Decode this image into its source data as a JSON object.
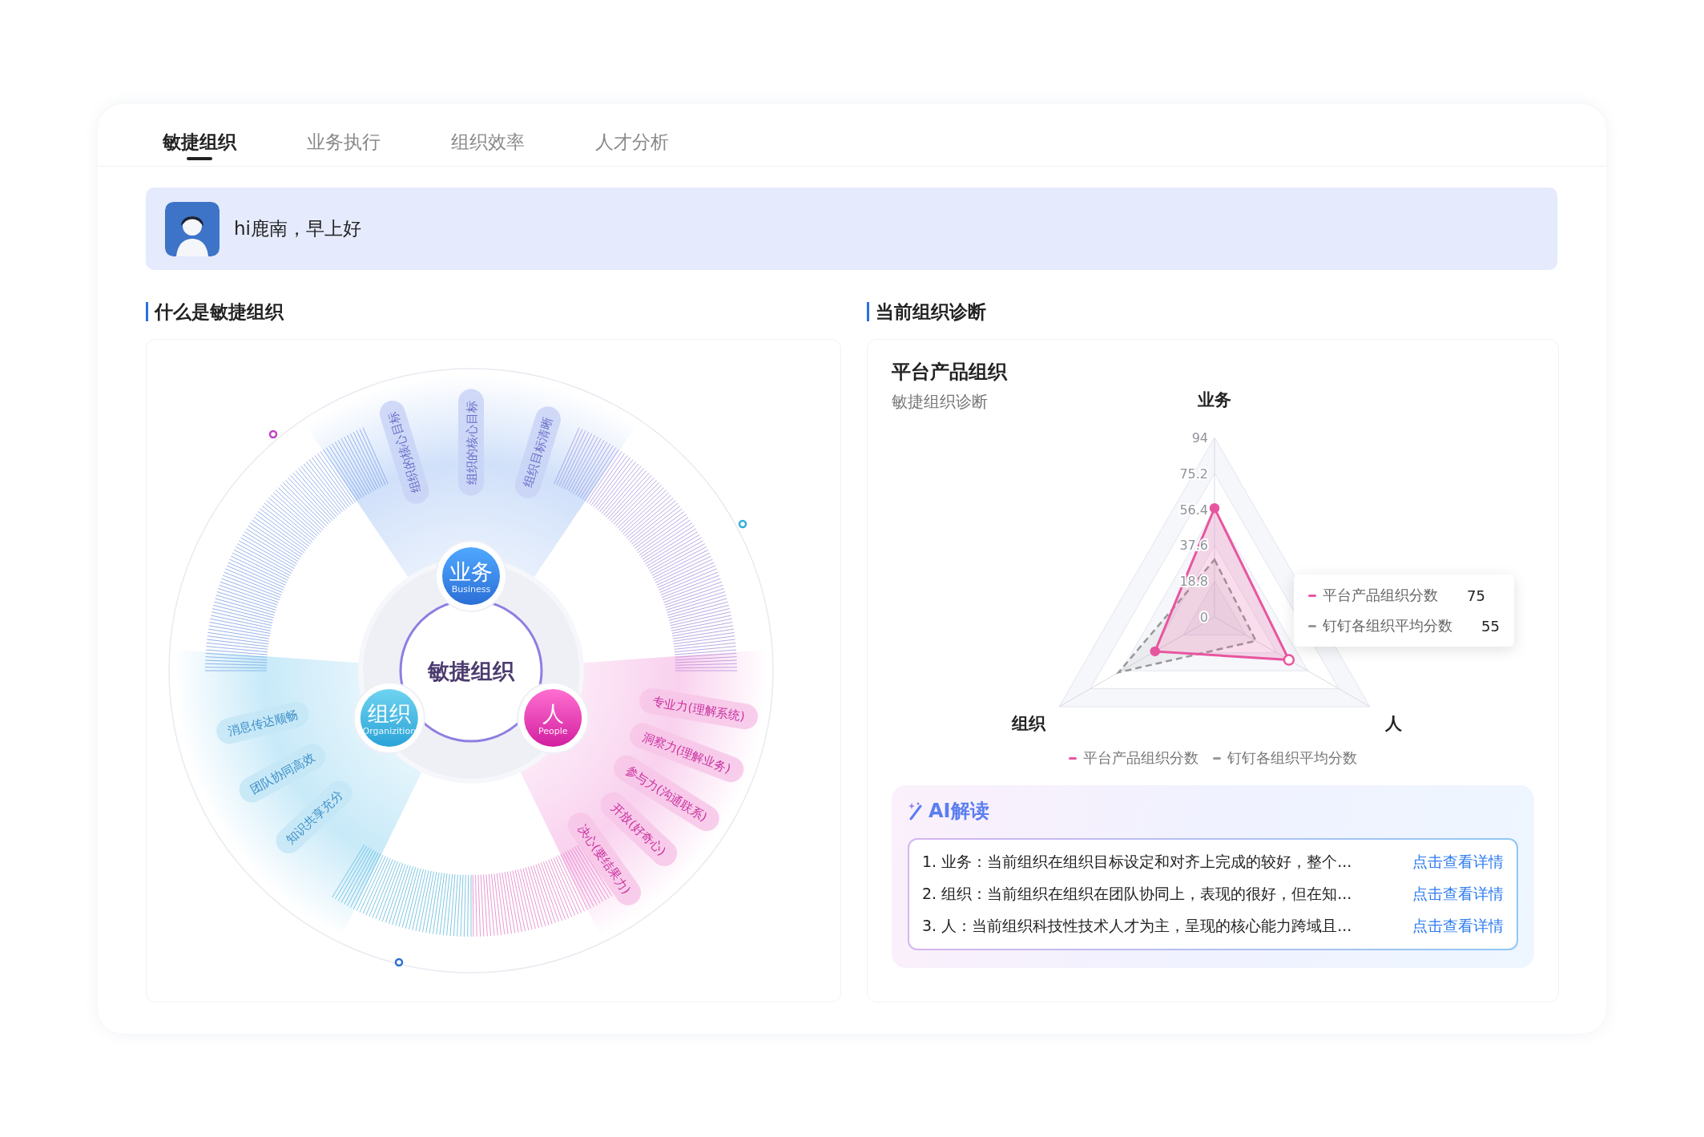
{
  "tabs": [
    {
      "label": "敏捷组织",
      "selected": true
    },
    {
      "label": "业务执行",
      "selected": false
    },
    {
      "label": "组织效率",
      "selected": false
    },
    {
      "label": "人才分析",
      "selected": false
    }
  ],
  "greeting": {
    "text": "hi鹿南，早上好"
  },
  "left_section": {
    "title": "什么是敏捷组织",
    "diagram": {
      "center": "敏捷组织",
      "pillars": [
        {
          "kind": "business",
          "name": "业务",
          "subtitle": "Business",
          "tags": [
            "组织的核心目标",
            "组织的核心目标",
            "组织目标清晰"
          ]
        },
        {
          "kind": "organization",
          "name": "组织",
          "subtitle": "Organizition",
          "tags": [
            "消息传达顺畅",
            "团队协同高效",
            "知识共享充分"
          ]
        },
        {
          "kind": "people",
          "name": "人",
          "subtitle": "People",
          "tags": [
            "专业力(理解系统)",
            "洞察力(理解业务)",
            "参与力(沟通联系)",
            "开放(好奇心)",
            "决心(要结果力)"
          ]
        }
      ]
    }
  },
  "right_section": {
    "title": "当前组织诊断",
    "card": {
      "title": "平台产品组织",
      "subtitle": "敏捷组织诊断",
      "chart_data": {
        "type": "radar",
        "categories": [
          "业务",
          "人",
          "组织"
        ],
        "ylim": [
          0,
          94
        ],
        "yticks": [
          0,
          18.8,
          37.6,
          56.4,
          75.2,
          94
        ],
        "legend": "bottom",
        "series": [
          {
            "name": "平台产品组织分数",
            "color": "#e8559f",
            "values": [
              57,
              45,
              36
            ]
          },
          {
            "name": "钉钉各组织平均分数",
            "color": "#999999",
            "values": [
              30,
              25,
              58
            ]
          }
        ]
      },
      "tooltip": {
        "items": [
          {
            "label": "平台产品组织分数",
            "value": "75",
            "color": "#e8559f"
          },
          {
            "label": "钉钉各组织平均分数",
            "value": "55",
            "color": "#999999"
          }
        ]
      },
      "ai": {
        "title": "AI解读",
        "items": [
          {
            "text": "1. 业务：当前组织在组织目标设定和对齐上完成的较好，整个...",
            "link": "点击查看详情"
          },
          {
            "text": "2. 组织：当前组织在组织在团队协同上，表现的很好，但在知...",
            "link": "点击查看详情"
          },
          {
            "text": "3. 人：当前组织科技性技术人才为主，呈现的核心能力跨域且...",
            "link": "点击查看详情"
          }
        ]
      }
    }
  }
}
